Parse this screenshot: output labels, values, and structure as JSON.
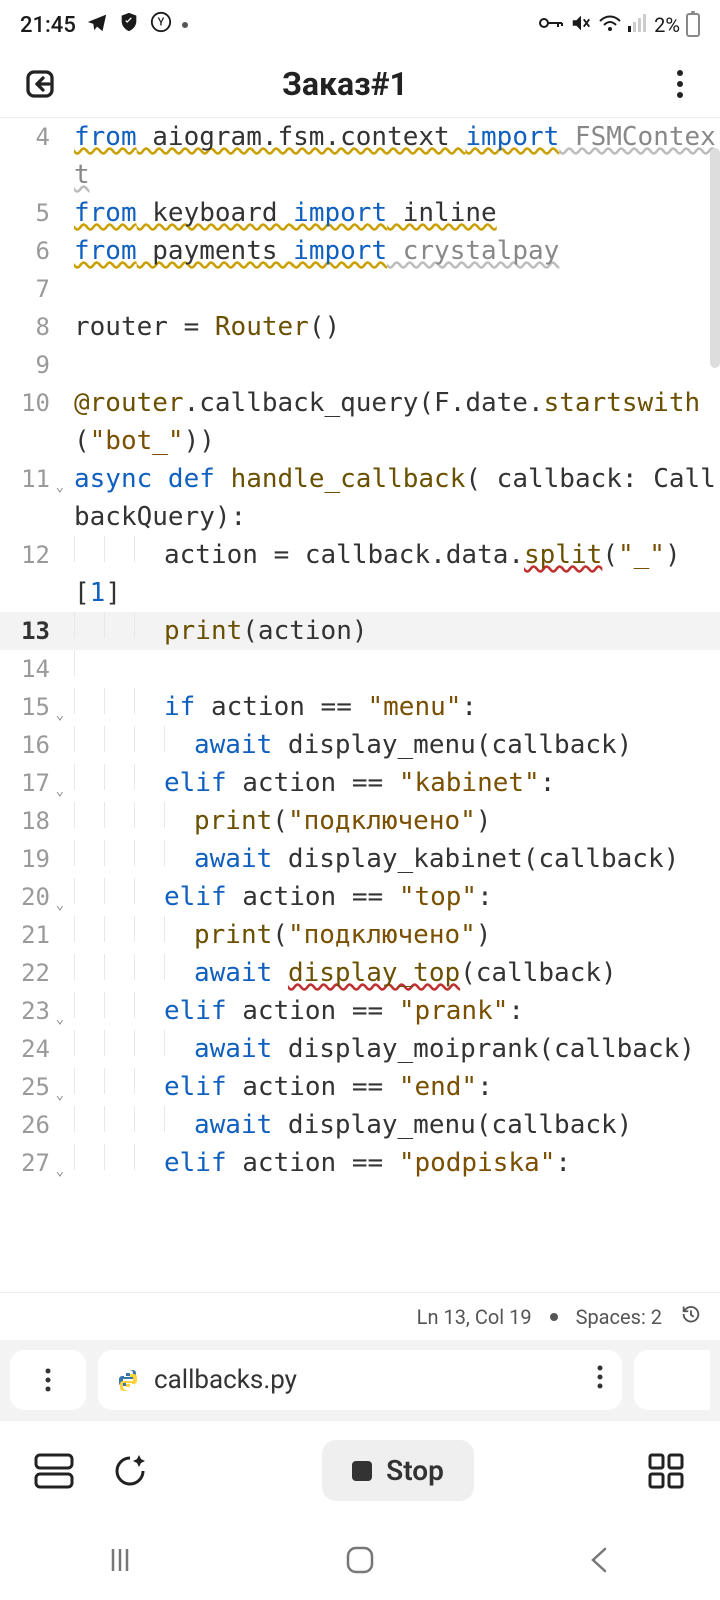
{
  "status": {
    "time": "21:45",
    "battery_pct": "2%"
  },
  "header": {
    "title": "Заказ#1"
  },
  "tab": {
    "filename": "callbacks.py"
  },
  "statusline": {
    "pos": "Ln 13, Col 19",
    "indent": "Spaces: 2"
  },
  "toolbar": {
    "stop": "Stop"
  },
  "code": {
    "l4_from": "from",
    "l4_mod": " aiogram.fsm.context ",
    "l4_import": "import",
    "l4_rest": " FSMContext",
    "l5_from": "from",
    "l5_mod": " keyboard ",
    "l5_import": "import",
    "l5_rest": " inline",
    "l6_from": "from",
    "l6_mod": " payments ",
    "l6_import": "import",
    "l6_rest": " crystalpay",
    "l8": "router = ",
    "l8_router": "Router",
    "l8_end": "()",
    "l10_at": "@router",
    "l10_b": ".callback_query(",
    "l10_F": "F",
    "l10_c": ".date.",
    "l10_sw": "startswith",
    "l10_d": "(",
    "l10_str": "\"bot_\"",
    "l10_e": "))",
    "l11_async": "async",
    "l11_def": " def ",
    "l11_name": "handle_callback",
    "l11_sig": "( callback: CallbackQuery):",
    "l12_a": "action = callback.data.",
    "l12_split": "split",
    "l12_b": "(",
    "l12_str": "\"_\"",
    "l12_c": ")[",
    "l12_num": "1",
    "l12_d": "]",
    "l13_print": "print",
    "l13_b": "(action)",
    "l15_if": "if",
    "l15_a": " action == ",
    "l15_str": "\"menu\"",
    "l15_c": ":",
    "l16_await": "await",
    "l16_b": " display_menu(callback)",
    "l17_elif": "elif",
    "l17_a": " action == ",
    "l17_str": "\"kabinet\"",
    "l17_c": ":",
    "l18_print": "print",
    "l18_b": "(",
    "l18_str": "\"подключено\"",
    "l18_c": ")",
    "l19_await": "await",
    "l19_b": " display_kabinet(callback)",
    "l20_elif": "elif",
    "l20_a": " action == ",
    "l20_str": "\"top\"",
    "l20_c": ":",
    "l21_print": "print",
    "l21_b": "(",
    "l21_str": "\"подключено\"",
    "l21_c": ")",
    "l22_await": "await",
    "l22_sp": " ",
    "l22_fn": "display_top",
    "l22_b": "(callback)",
    "l23_elif": "elif",
    "l23_a": " action == ",
    "l23_str": "\"prank\"",
    "l23_c": ":",
    "l24_await": "await",
    "l24_b": " display_moiprank(callback)",
    "l25_elif": "elif",
    "l25_a": " action == ",
    "l25_str": "\"end\"",
    "l25_c": ":",
    "l26_await": "await",
    "l26_b": " display_menu(callback)",
    "l27_elif": "elif",
    "l27_a": " action == ",
    "l27_str": "\"podpiska\"",
    "l27_c": ":"
  },
  "gutters": {
    "g4": "4",
    "g5": "5",
    "g6": "6",
    "g7": "7",
    "g8": "8",
    "g9": "9",
    "g10": "10",
    "g11": "11",
    "g12": "12",
    "g13": "13",
    "g14": "14",
    "g15": "15",
    "g16": "16",
    "g17": "17",
    "g18": "18",
    "g19": "19",
    "g20": "20",
    "g21": "21",
    "g22": "22",
    "g23": "23",
    "g24": "24",
    "g25": "25",
    "g26": "26",
    "g27": "27"
  }
}
